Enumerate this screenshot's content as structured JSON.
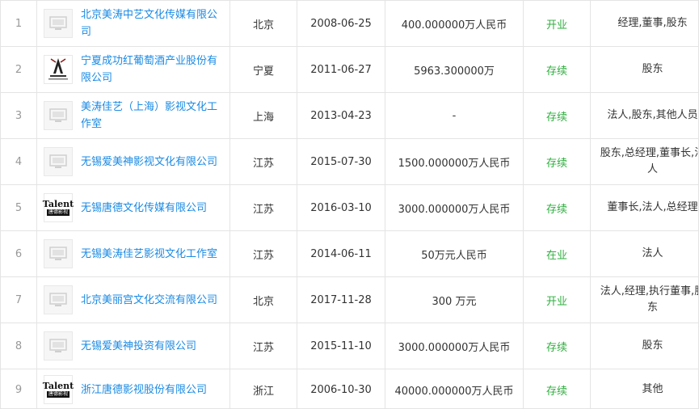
{
  "rows": [
    {
      "index": "1",
      "name": "北京美涛中艺文化传媒有限公司",
      "logo": "placeholder-icon",
      "province": "北京",
      "date": "2008-06-25",
      "capital": "400.000000万人民币",
      "status": "开业",
      "roles": "经理,董事,股东"
    },
    {
      "index": "2",
      "name": "宁夏成功红葡萄酒产业股份有限公司",
      "logo": "wine-logo-icon",
      "province": "宁夏",
      "date": "2011-06-27",
      "capital": "5963.300000万",
      "status": "存续",
      "roles": "股东"
    },
    {
      "index": "3",
      "name": "美涛佳艺（上海）影视文化工作室",
      "logo": "placeholder-icon",
      "province": "上海",
      "date": "2013-04-23",
      "capital": "-",
      "status": "存续",
      "roles": "法人,股东,其他人员"
    },
    {
      "index": "4",
      "name": "无锡爱美神影视文化有限公司",
      "logo": "placeholder-icon",
      "province": "江苏",
      "date": "2015-07-30",
      "capital": "1500.000000万人民币",
      "status": "存续",
      "roles": "股东,总经理,董事长,法人"
    },
    {
      "index": "5",
      "name": "无锡唐德文化传媒有限公司",
      "logo": "talent-logo-icon",
      "province": "江苏",
      "date": "2016-03-10",
      "capital": "3000.000000万人民币",
      "status": "存续",
      "roles": "董事长,法人,总经理"
    },
    {
      "index": "6",
      "name": "无锡美涛佳艺影视文化工作室",
      "logo": "placeholder-icon",
      "province": "江苏",
      "date": "2014-06-11",
      "capital": "50万元人民币",
      "status": "在业",
      "roles": "法人"
    },
    {
      "index": "7",
      "name": "北京美丽宫文化交流有限公司",
      "logo": "placeholder-icon",
      "province": "北京",
      "date": "2017-11-28",
      "capital": "300 万元",
      "status": "开业",
      "roles": "法人,经理,执行董事,股东"
    },
    {
      "index": "8",
      "name": "无锡爱美神投资有限公司",
      "logo": "placeholder-icon",
      "province": "江苏",
      "date": "2015-11-10",
      "capital": "3000.000000万人民币",
      "status": "存续",
      "roles": "股东"
    },
    {
      "index": "9",
      "name": "浙江唐德影视股份有限公司",
      "logo": "talent-logo-icon",
      "province": "浙江",
      "date": "2006-10-30",
      "capital": "40000.000000万人民币",
      "status": "存续",
      "roles": "其他"
    }
  ],
  "talent_logo": {
    "title": "Talent",
    "subtitle": "唐德影视"
  },
  "colors": {
    "link": "#1a8ae4",
    "status": "#2fae3f",
    "border": "#e4e4e4"
  }
}
